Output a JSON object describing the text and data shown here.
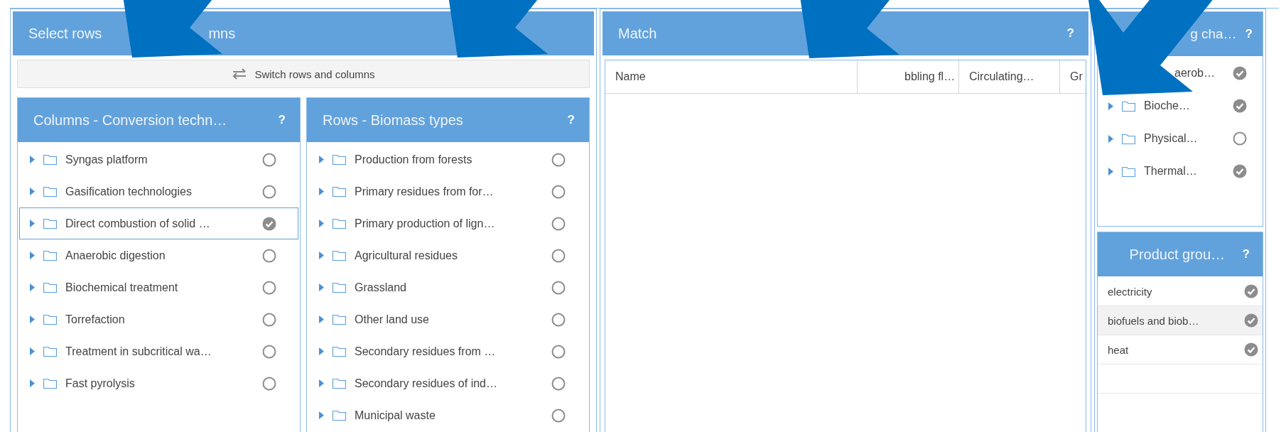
{
  "selection_panel": {
    "title_parts": [
      "Select rows",
      "mns"
    ],
    "switch_button": "Switch rows and columns",
    "columns_panel": {
      "title": "Columns - Conversion techn…",
      "help": "?",
      "items": [
        {
          "label": "Syngas platform",
          "checked": false,
          "selected": false
        },
        {
          "label": "Gasification technologies",
          "checked": false,
          "selected": false
        },
        {
          "label": "Direct combustion of solid …",
          "checked": true,
          "selected": true
        },
        {
          "label": "Anaerobic digestion",
          "checked": false,
          "selected": false
        },
        {
          "label": "Biochemical treatment",
          "checked": false,
          "selected": false
        },
        {
          "label": "Torrefaction",
          "checked": false,
          "selected": false
        },
        {
          "label": "Treatment in subcritical wa…",
          "checked": false,
          "selected": false
        },
        {
          "label": "Fast pyrolysis",
          "checked": false,
          "selected": false
        }
      ]
    },
    "rows_panel": {
      "title": "Rows - Biomass types",
      "help": "?",
      "items": [
        {
          "label": "Production from forests",
          "checked": false,
          "selected": false
        },
        {
          "label": "Primary residues from for…",
          "checked": false,
          "selected": false
        },
        {
          "label": "Primary production of lign…",
          "checked": false,
          "selected": false
        },
        {
          "label": "Agricultural residues",
          "checked": false,
          "selected": false
        },
        {
          "label": "Grassland",
          "checked": false,
          "selected": false
        },
        {
          "label": "Other land use",
          "checked": false,
          "selected": false
        },
        {
          "label": "Secondary residues from …",
          "checked": false,
          "selected": false
        },
        {
          "label": "Secondary residues of ind…",
          "checked": false,
          "selected": false
        },
        {
          "label": "Municipal waste",
          "checked": false,
          "selected": false
        }
      ]
    }
  },
  "match_panel": {
    "title": "Match",
    "help": "?",
    "columns": [
      "Name",
      "bbling fl…",
      "Circulating…",
      "Gr"
    ]
  },
  "filter_panel": {
    "title": "g cha…",
    "help": "?",
    "items": [
      {
        "label": "aerob…",
        "checked": true,
        "covered": true
      },
      {
        "label": "Bioche…",
        "checked": true,
        "covered": false
      },
      {
        "label": "Physical…",
        "checked": false,
        "covered": false
      },
      {
        "label": "Thermal…",
        "checked": true,
        "covered": false
      }
    ]
  },
  "product_panel": {
    "title": "Product grou…",
    "help": "?",
    "items": [
      {
        "label": "electricity",
        "checked": true,
        "highlighted": false
      },
      {
        "label": "biofuels and biob…",
        "checked": true,
        "highlighted": true
      },
      {
        "label": "heat",
        "checked": true,
        "highlighted": false
      }
    ]
  },
  "arrows": [
    {
      "kind": "pointer"
    },
    {
      "kind": "pointer"
    },
    {
      "kind": "pointer"
    },
    {
      "kind": "pointer"
    }
  ]
}
